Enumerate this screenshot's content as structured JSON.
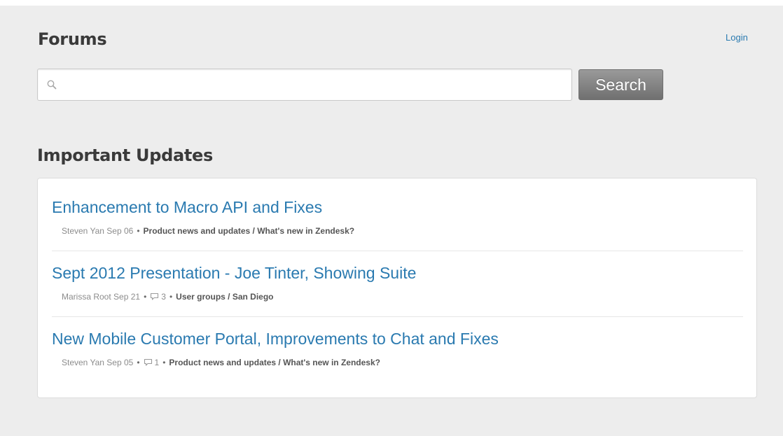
{
  "header": {
    "title": "Forums",
    "login_label": "Login"
  },
  "search": {
    "placeholder": "",
    "value": "",
    "button_label": "Search"
  },
  "section": {
    "title": "Important Updates"
  },
  "topics": [
    {
      "title": "Enhancement to Macro API and Fixes",
      "author_date": "Steven Yan Sep 06",
      "comments": "",
      "path": "Product news and updates / What's new in Zendesk?"
    },
    {
      "title": "Sept 2012 Presentation - Joe Tinter, Showing Suite",
      "author_date": "Marissa Root Sep 21",
      "comments": "3",
      "path": "User groups / San Diego"
    },
    {
      "title": "New Mobile Customer Portal, Improvements to Chat and Fixes",
      "author_date": "Steven Yan Sep 05",
      "comments": "1",
      "path": "Product news and updates / What's new in Zendesk?"
    }
  ],
  "theme": {
    "link_color": "#2a7ab0",
    "heading_color": "#3a3a3a",
    "background": "#ededed"
  }
}
